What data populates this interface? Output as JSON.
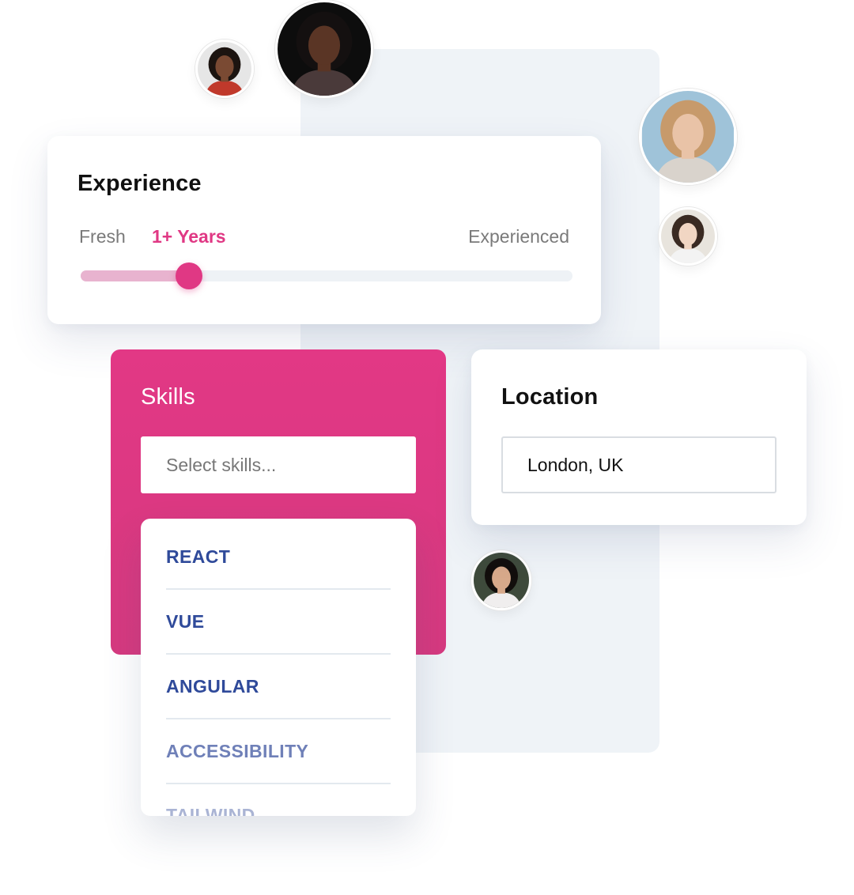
{
  "experience": {
    "title": "Experience",
    "levels": {
      "fresh": "Fresh",
      "selected": "1+ Years",
      "experienced": "Experienced"
    },
    "slider_value_fraction": 0.22
  },
  "skills": {
    "title": "Skills",
    "input_placeholder": "Select skills...",
    "options": [
      "REACT",
      "VUE",
      "ANGULAR",
      "ACCESSIBILITY",
      "TAILWIND"
    ]
  },
  "location": {
    "title": "Location",
    "value": "London, UK"
  },
  "colors": {
    "accent": "#e03884",
    "option_text": "#2f4a9a",
    "slider_fill": "#e8b3cf",
    "panel_bg": "#eff3f7"
  },
  "avatars": [
    {
      "name": "avatar-woman-curly-hair",
      "skin": "#7a4a33",
      "hair": "#1c1410",
      "bg": "#e6e6e6",
      "shirt": "#c0392b"
    },
    {
      "name": "avatar-man-dark-background",
      "skin": "#5a3525",
      "hair": "#141010",
      "bg": "#0d0d0d",
      "shirt": "#4a3a3a"
    },
    {
      "name": "avatar-woman-black-hat",
      "skin": "#e9c3a7",
      "hair": "#c79a6b",
      "bg": "#9fc3d9",
      "shirt": "#d9d3cc"
    },
    {
      "name": "avatar-woman-light-background",
      "skin": "#f1d6c3",
      "hair": "#3a2a22",
      "bg": "#e8e4dd",
      "shirt": "#f3f3f3"
    },
    {
      "name": "avatar-woman-dark-hair",
      "skin": "#d7a98a",
      "hair": "#120e0c",
      "bg": "#3e4a3b",
      "shirt": "#f0eeee"
    }
  ]
}
